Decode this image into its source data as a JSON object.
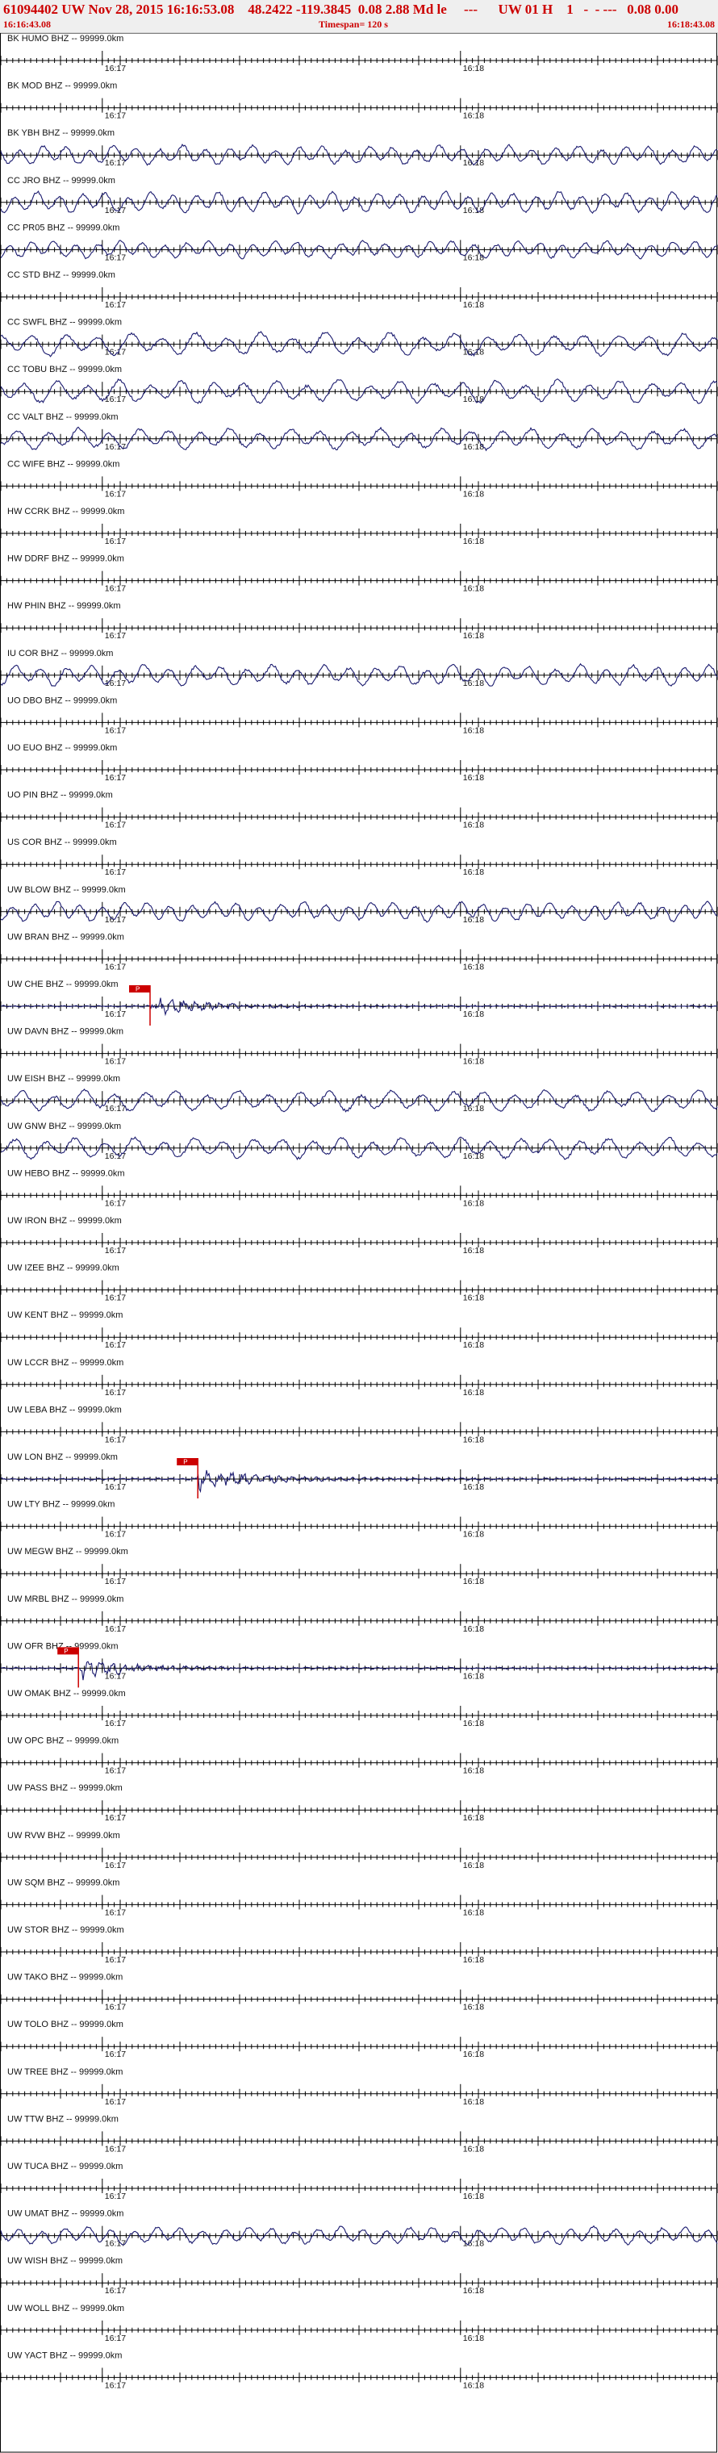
{
  "header": {
    "title": "61094402 UW Nov 28, 2015 16:16:53.08    48.2422 -119.3845  0.08 2.88 Md le     ---      UW 01 H    1   -  - ---   0.08 0.00",
    "start_time": "16:16:43.08",
    "timespan": "Timespan= 120 s",
    "end_time": "16:18:43.08"
  },
  "chart_data": {
    "type": "line",
    "title": "61094402 UW Nov 28, 2015 16:16:53.08",
    "x_range_seconds": [
      0,
      120
    ],
    "time_ticks": [
      {
        "label": "16:17",
        "t": 17
      },
      {
        "label": "16:18",
        "t": 77
      }
    ],
    "colors": {
      "trace": "#1a1a6e",
      "pick": "#cc0000",
      "label": "#111111"
    },
    "traces": [
      {
        "label": "BK HUMO BHZ -- 99999.0km",
        "amp": 0
      },
      {
        "label": "BK MOD BHZ -- 99999.0km",
        "amp": 0
      },
      {
        "label": "BK YBH BHZ -- 99999.0km",
        "amp": 0.55
      },
      {
        "label": "CC JRO BHZ -- 99999.0km",
        "amp": 0.6
      },
      {
        "label": "CC PR05 BHZ -- 99999.0km",
        "amp": 0.5
      },
      {
        "label": "CC STD BHZ -- 99999.0km",
        "amp": 0
      },
      {
        "label": "CC SWFL BHZ -- 99999.0km",
        "amp": 0.65
      },
      {
        "label": "CC TOBU BHZ -- 99999.0km",
        "amp": 0.65
      },
      {
        "label": "CC VALT BHZ -- 99999.0km",
        "amp": 0.6
      },
      {
        "label": "CC WIFE BHZ -- 99999.0km",
        "amp": 0
      },
      {
        "label": "HW CCRK BHZ -- 99999.0km",
        "amp": 0
      },
      {
        "label": "HW DDRF BHZ -- 99999.0km",
        "amp": 0
      },
      {
        "label": "HW PHIN BHZ -- 99999.0km",
        "amp": 0
      },
      {
        "label": "IU COR BHZ -- 99999.0km",
        "amp": 0.6
      },
      {
        "label": "UO DBO BHZ -- 99999.0km",
        "amp": 0
      },
      {
        "label": "UO EUO BHZ -- 99999.0km",
        "amp": 0
      },
      {
        "label": "UO PIN BHZ -- 99999.0km",
        "amp": 0
      },
      {
        "label": "US COR BHZ -- 99999.0km",
        "amp": 0
      },
      {
        "label": "UW BLOW BHZ -- 99999.0km",
        "amp": 0.55
      },
      {
        "label": "UW BRAN BHZ -- 99999.0km",
        "amp": 0
      },
      {
        "label": "UW CHE BHZ -- 99999.0km",
        "amp": 0.5,
        "pick": 25,
        "pick_label": "P"
      },
      {
        "label": "UW DAVN BHZ -- 99999.0km",
        "amp": 0
      },
      {
        "label": "UW EISH BHZ -- 99999.0km",
        "amp": 0.6
      },
      {
        "label": "UW GNW BHZ -- 99999.0km",
        "amp": 0.6
      },
      {
        "label": "UW HEBO BHZ -- 99999.0km",
        "amp": 0
      },
      {
        "label": "UW IRON BHZ -- 99999.0km",
        "amp": 0
      },
      {
        "label": "UW IZEE BHZ -- 99999.0km",
        "amp": 0
      },
      {
        "label": "UW KENT BHZ -- 99999.0km",
        "amp": 0
      },
      {
        "label": "UW LCCR BHZ -- 99999.0km",
        "amp": 0
      },
      {
        "label": "UW LEBA BHZ -- 99999.0km",
        "amp": 0
      },
      {
        "label": "UW LON BHZ -- 99999.0km",
        "amp": 0.6,
        "pick": 33,
        "pick_label": "P"
      },
      {
        "label": "UW LTY BHZ -- 99999.0km",
        "amp": 0
      },
      {
        "label": "UW MEGW BHZ -- 99999.0km",
        "amp": 0
      },
      {
        "label": "UW MRBL BHZ -- 99999.0km",
        "amp": 0
      },
      {
        "label": "UW OFR BHZ -- 99999.0km",
        "amp": 0.55,
        "pick": 13,
        "pick_label": "P"
      },
      {
        "label": "UW OMAK BHZ -- 99999.0km",
        "amp": 0
      },
      {
        "label": "UW OPC BHZ -- 99999.0km",
        "amp": 0
      },
      {
        "label": "UW PASS BHZ -- 99999.0km",
        "amp": 0
      },
      {
        "label": "UW RVW BHZ -- 99999.0km",
        "amp": 0
      },
      {
        "label": "UW SQM BHZ -- 99999.0km",
        "amp": 0
      },
      {
        "label": "UW STOR BHZ -- 99999.0km",
        "amp": 0
      },
      {
        "label": "UW TAKO BHZ -- 99999.0km",
        "amp": 0
      },
      {
        "label": "UW TOLO BHZ -- 99999.0km",
        "amp": 0
      },
      {
        "label": "UW TREE BHZ -- 99999.0km",
        "amp": 0
      },
      {
        "label": "UW TTW BHZ -- 99999.0km",
        "amp": 0
      },
      {
        "label": "UW TUCA BHZ -- 99999.0km",
        "amp": 0
      },
      {
        "label": "UW UMAT BHZ -- 99999.0km",
        "amp": 0.5
      },
      {
        "label": "UW WISH BHZ -- 99999.0km",
        "amp": 0
      },
      {
        "label": "UW WOLL BHZ -- 99999.0km",
        "amp": 0
      },
      {
        "label": "UW YACT BHZ -- 99999.0km",
        "amp": 0
      }
    ]
  }
}
